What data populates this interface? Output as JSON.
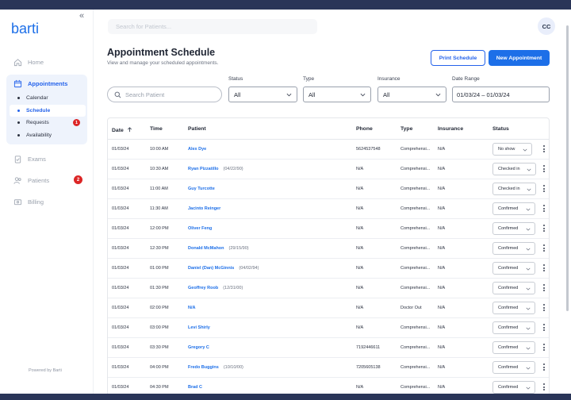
{
  "brand": {
    "logo_text": "barti",
    "accent": "#1d6fe8",
    "danger": "#dc2626"
  },
  "topbar": {
    "search_placeholder": "Search for Patients...",
    "avatar_initials": "CC"
  },
  "sidebar": {
    "collapse_icon": "double-chevron-left-icon",
    "items": [
      {
        "label": "Home",
        "icon": "home-icon"
      },
      {
        "label": "Appointments",
        "icon": "calendar-icon"
      },
      {
        "label": "Exams",
        "icon": "clipboard-icon"
      },
      {
        "label": "Patients",
        "icon": "users-icon",
        "badge": "2"
      },
      {
        "label": "Billing",
        "icon": "billing-icon"
      }
    ],
    "subitems": [
      {
        "label": "Calendar"
      },
      {
        "label": "Schedule"
      },
      {
        "label": "Requests",
        "badge": "1"
      },
      {
        "label": "Availability"
      }
    ],
    "footer": "Powered by Barti"
  },
  "page": {
    "title": "Appointment Schedule",
    "subtitle": "View and manage your scheduled appointments.",
    "print_label": "Print Schedule",
    "new_label": "New Appointment"
  },
  "filters": {
    "search_placeholder": "Search Patient",
    "status_label": "Status",
    "status_value": "All",
    "type_label": "Type",
    "type_value": "All",
    "insurance_label": "Insurance",
    "insurance_value": "All",
    "date_label": "Date Range",
    "date_value": "01/03/24 – 01/03/24"
  },
  "table": {
    "columns": {
      "date": "Date",
      "time": "Time",
      "patient": "Patient",
      "phone": "Phone",
      "type": "Type",
      "insurance": "Insurance",
      "status": "Status"
    },
    "rows": [
      {
        "date": "01/03/24",
        "time": "10:00 AM",
        "patient": "Alex Dye",
        "dob": "",
        "phone": "5624537548",
        "type": "Comprehensi...",
        "insurance": "N/A",
        "status": "No show"
      },
      {
        "date": "01/03/24",
        "time": "10:30 AM",
        "patient": "Ryan Pizzatillo",
        "dob": "(04/22/90)",
        "phone": "N/A",
        "type": "Comprehensi...",
        "insurance": "N/A",
        "status": "Checked in"
      },
      {
        "date": "01/03/24",
        "time": "11:00 AM",
        "patient": "Guy Turcotte",
        "dob": "",
        "phone": "N/A",
        "type": "Comprehensi...",
        "insurance": "N/A",
        "status": "Checked in"
      },
      {
        "date": "01/03/24",
        "time": "11:30 AM",
        "patient": "Jacinto Reinger",
        "dob": "",
        "phone": "N/A",
        "type": "Comprehensi...",
        "insurance": "N/A",
        "status": "Confirmed"
      },
      {
        "date": "01/03/24",
        "time": "12:00 PM",
        "patient": "Oliver Feng",
        "dob": "",
        "phone": "N/A",
        "type": "Comprehensi...",
        "insurance": "N/A",
        "status": "Confirmed"
      },
      {
        "date": "01/03/24",
        "time": "12:30 PM",
        "patient": "Donald McMahon",
        "dob": "(29/15/90)",
        "phone": "N/A",
        "type": "Comprehensi...",
        "insurance": "N/A",
        "status": "Confirmed"
      },
      {
        "date": "01/03/24",
        "time": "01:00 PM",
        "patient": "Daniel (Dan) McGinnis",
        "dob": "(04/02/94)",
        "phone": "N/A",
        "type": "Comprehensi...",
        "insurance": "N/A",
        "status": "Confirmed"
      },
      {
        "date": "01/03/24",
        "time": "01:30 PM",
        "patient": "Geoffrey Roob",
        "dob": "(12/31/00)",
        "phone": "N/A",
        "type": "Comprehensi...",
        "insurance": "N/A",
        "status": "Confirmed"
      },
      {
        "date": "01/03/24",
        "time": "02:00 PM",
        "patient": "N/A",
        "dob": "",
        "phone": "N/A",
        "type": "Doctor Out",
        "insurance": "N/A",
        "status": "Confirmed"
      },
      {
        "date": "01/03/24",
        "time": "03:00 PM",
        "patient": "Levi Shirly",
        "dob": "",
        "phone": "N/A",
        "type": "Comprehensi...",
        "insurance": "N/A",
        "status": "Confirmed"
      },
      {
        "date": "01/03/24",
        "time": "03:30 PM",
        "patient": "Gregory C",
        "dob": "",
        "phone": "7192446611",
        "type": "Comprehensi...",
        "insurance": "N/A",
        "status": "Confirmed"
      },
      {
        "date": "01/03/24",
        "time": "04:00 PM",
        "patient": "Fredo Buggins",
        "dob": "(10/10/00)",
        "phone": "7205605138",
        "type": "Comprehensi...",
        "insurance": "N/A",
        "status": "Confirmed"
      },
      {
        "date": "01/03/24",
        "time": "04:30 PM",
        "patient": "Brad C",
        "dob": "",
        "phone": "N/A",
        "type": "Comprehensi...",
        "insurance": "N/A",
        "status": "Confirmed"
      }
    ]
  }
}
